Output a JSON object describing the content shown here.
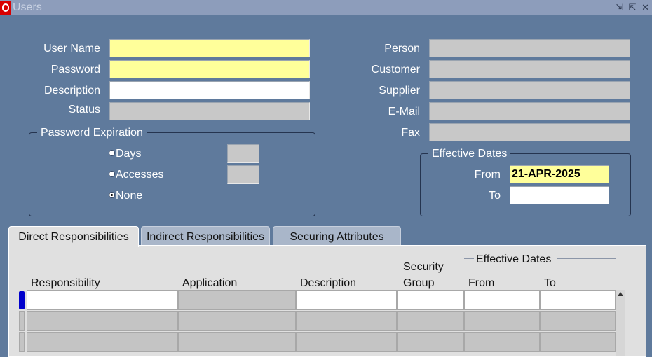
{
  "window": {
    "title": "Users",
    "controls": "⇲ ⇱ ✕"
  },
  "form": {
    "user_name": {
      "label": "User Name",
      "value": ""
    },
    "password": {
      "label": "Password",
      "value": ""
    },
    "description": {
      "label": "Description",
      "value": ""
    },
    "status": {
      "label": "Status",
      "value": ""
    },
    "person": {
      "label": "Person",
      "value": ""
    },
    "customer": {
      "label": "Customer",
      "value": ""
    },
    "supplier": {
      "label": "Supplier",
      "value": ""
    },
    "email": {
      "label": "E-Mail",
      "value": ""
    },
    "fax": {
      "label": "Fax",
      "value": ""
    }
  },
  "password_expiration": {
    "title": "Password Expiration",
    "days": {
      "label": "Days",
      "value": ""
    },
    "accesses": {
      "label": "Accesses",
      "value": ""
    },
    "none": {
      "label": "None",
      "selected": true
    }
  },
  "effective_dates": {
    "title": "Effective Dates",
    "from": {
      "label": "From",
      "value": "21-APR-2025"
    },
    "to": {
      "label": "To",
      "value": ""
    }
  },
  "tabs": [
    {
      "label": "Direct Responsibilities",
      "active": true
    },
    {
      "label": "Indirect Responsibilities",
      "active": false
    },
    {
      "label": "Securing Attributes",
      "active": false
    }
  ],
  "grid": {
    "columns": {
      "responsibility": "Responsibility",
      "application": "Application",
      "description": "Description",
      "security_group_1": "Security",
      "security_group_2": "Group",
      "from": "From",
      "to": "To"
    },
    "effective_dates_header": "Effective Dates"
  }
}
